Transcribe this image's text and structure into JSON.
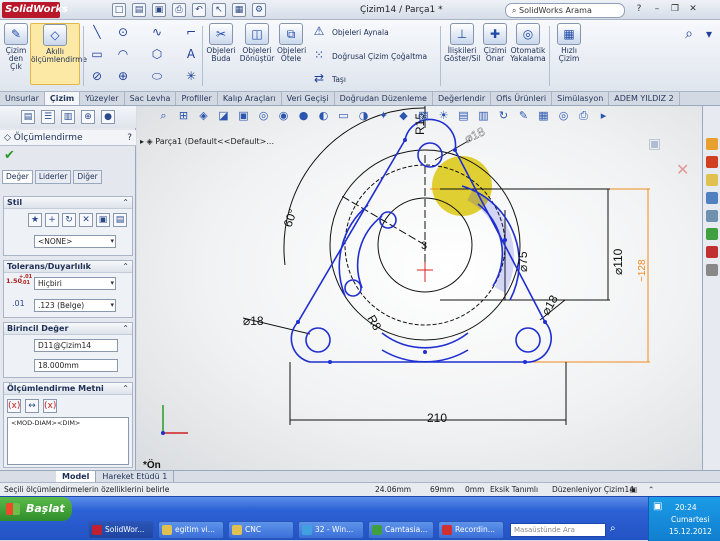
{
  "app": {
    "logo": "SolidWorks",
    "doc_title": "Çizim14 / Parça1 *",
    "search_placeholder": "SolidWorks Arama"
  },
  "quick_access": [
    "new-icon",
    "open-icon",
    "save-icon",
    "print-icon",
    "undo-icon",
    "select-icon",
    "rebuild-icon",
    "options-icon"
  ],
  "ribbon": {
    "sketch_exit": "Çizim\nden\nÇık",
    "smart_dim": "Akıllı\nölçümlendirme",
    "trim": "Objeleri\nBuda",
    "convert": "Objeleri\nDönüştür",
    "offset": "Objeleri\nÖtele",
    "mirror": "Objeleri Aynala",
    "linear_pattern": "Doğrusal Çizim Çoğaltma",
    "move": "Taşı",
    "relations": "İlişkileri\nGöster/Sil",
    "repair": "Çizimi\nOnar",
    "snap": "Otomatik\nYakalama",
    "rapid": "Hızlı Çizim"
  },
  "tabs": [
    "Unsurlar",
    "Çizim",
    "Yüzeyler",
    "Sac Levha",
    "Profiller",
    "Kalıp Araçları",
    "Veri Geçişi",
    "Doğrudan Düzenleme",
    "Değerlendir",
    "Ofis Ürünleri",
    "Simülasyon",
    "ADEM YILDIZ 2"
  ],
  "active_tab": "Çizim",
  "property_manager": {
    "title": "Ölçümlendirme",
    "tabs": [
      "Değer",
      "Liderler",
      "Diğer"
    ],
    "style_group": "Stil",
    "style_value": "<NONE>",
    "tolerance_group": "Tolerans/Duyarlılık",
    "tolerance_value": "Hiçbiri",
    "tol_icon_top": "1.50",
    "tol_icon_sup": "+.01",
    "tol_icon_sub": "-.01",
    "precision_value": ".123 (Belge)",
    "primary_group": "Birincil Değer",
    "primary_name": "D11@Çizim14",
    "primary_value": "18.000mm",
    "text_group": "Ölçümlendirme Metni",
    "text_value": "<MOD-DIAM><DIM>"
  },
  "feature_tree": {
    "item": "Parça1  (Default<<Default>..."
  },
  "dimensions": {
    "r15": "R15",
    "d18_top": "⌀18",
    "angle60": "60°",
    "center3": "3",
    "d75": "⌀75",
    "d110": "⌀110",
    "d18_right": "⌀18",
    "d18_left": "⌀18",
    "r8": "R8",
    "w210": "210",
    "offset_dim": "~128"
  },
  "view_label": "*Ön",
  "model_tabs": [
    "Model",
    "Hareket Etüdü 1"
  ],
  "active_model_tab": "Model",
  "status": {
    "message": "Seçili ölçümlendirmelerin özelliklerini belirle",
    "x": "24.06mm",
    "y": "69mm",
    "z": "0mm",
    "state": "Eksik Tanımlı",
    "editing": "Düzenleniyor Çizim14"
  },
  "taskbar": {
    "start": "Başlat",
    "buttons": [
      "SolidWor...",
      "egitim vi...",
      "CNC",
      "32 - Win...",
      "Camtasia...",
      "Recordin..."
    ],
    "search_placeholder": "Masaüstünde Ara",
    "time": "20:24",
    "day": "Cumartesi",
    "date": "15.12.2012"
  },
  "colors": {
    "sketch_blue": "#1f2fd0",
    "dim_black": "#111111",
    "orange_dim": "#f08a1a",
    "highlight": "#d9c400"
  }
}
